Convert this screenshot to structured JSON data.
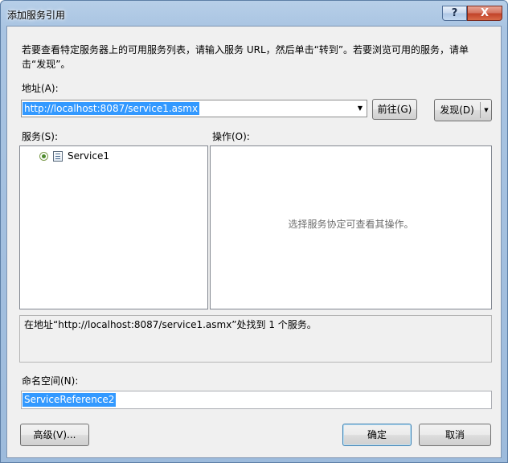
{
  "window": {
    "title": "添加服务引用",
    "help_glyph": "?",
    "close_glyph": "X"
  },
  "instruction": "若要查看特定服务器上的可用服务列表，请输入服务 URL，然后单击“转到”。若要浏览可用的服务，请单击“发现”。",
  "address": {
    "label": "地址(A):",
    "value": "http://localhost:8087/service1.asmx",
    "dropdown_glyph": "▼"
  },
  "buttons": {
    "go": "前往(G)",
    "discover": "发现(D)",
    "discover_arrow": "▼",
    "advanced": "高级(V)...",
    "ok": "确定",
    "cancel": "取消"
  },
  "services": {
    "label": "服务(S):",
    "items": [
      {
        "label": "Service1"
      }
    ]
  },
  "operations": {
    "label": "操作(O):",
    "hint": "选择服务协定可查看其操作。"
  },
  "status": "在地址“http://localhost:8087/service1.asmx”处找到 1 个服务。",
  "namespace": {
    "label": "命名空间(N):",
    "value": "ServiceReference2"
  }
}
